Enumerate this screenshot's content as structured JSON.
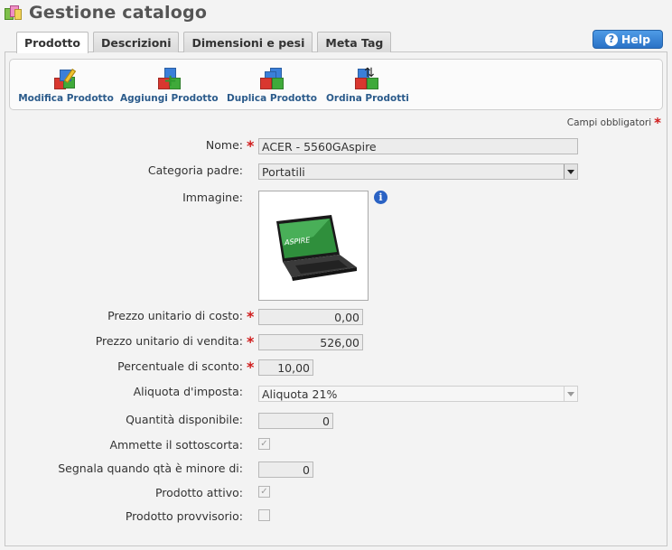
{
  "page": {
    "title": "Gestione catalogo"
  },
  "tabs": [
    "Prodotto",
    "Descrizioni",
    "Dimensioni e pesi",
    "Meta Tag"
  ],
  "help_label": "Help",
  "toolbar": {
    "modifica": "Modifica Prodotto",
    "aggiungi": "Aggiungi Prodotto",
    "duplica": "Duplica Prodotto",
    "ordina": "Ordina Prodotti"
  },
  "required_note": "Campi obbligatori",
  "form": {
    "nome_label": "Nome:",
    "nome_value": "ACER - 5560GAspire",
    "categoria_label": "Categoria padre:",
    "categoria_value": "Portatili",
    "immagine_label": "Immagine:",
    "costo_label": "Prezzo unitario di costo:",
    "costo_value": "0,00",
    "vendita_label": "Prezzo unitario di vendita:",
    "vendita_value": "526,00",
    "sconto_label": "Percentuale di sconto:",
    "sconto_value": "10,00",
    "aliquota_label": "Aliquota d'imposta:",
    "aliquota_value": "Aliquota 21%",
    "quantita_label": "Quantità disponibile:",
    "quantita_value": "0",
    "sottoscorta_label": "Ammette il sottoscorta:",
    "sottoscorta_checked": true,
    "segnala_label": "Segnala quando qtà è minore di:",
    "segnala_value": "0",
    "attivo_label": "Prodotto attivo:",
    "attivo_checked": true,
    "provvisorio_label": "Prodotto provvisorio:",
    "provvisorio_checked": false
  },
  "image": {
    "screen_text": "ASPIRE"
  },
  "colors": {
    "accent": "#2a72c6",
    "required": "#d01c1c",
    "link": "#2b5b8b"
  }
}
